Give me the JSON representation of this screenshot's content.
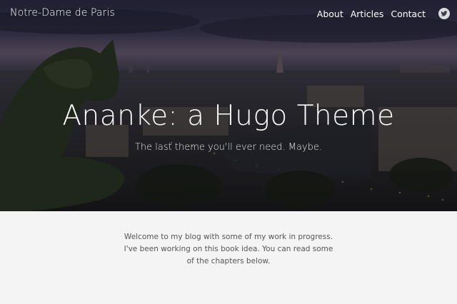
{
  "header": {
    "site_title": "Notre-Dame de Paris",
    "menu": [
      {
        "label": "About"
      },
      {
        "label": "Articles"
      },
      {
        "label": "Contact"
      }
    ],
    "social_icon": "twitter-icon"
  },
  "hero": {
    "title": "Ananke: a Hugo Theme",
    "subtitle": "The last theme you'll ever need. Maybe."
  },
  "main": {
    "intro": "Welcome to my blog with some of my work in progress. I've been working on this book idea. You can read some of the chapters below."
  },
  "colors": {
    "hero_sky": "#3d3a52",
    "page_background": "#f4f4f4",
    "body_text": "#555555"
  }
}
